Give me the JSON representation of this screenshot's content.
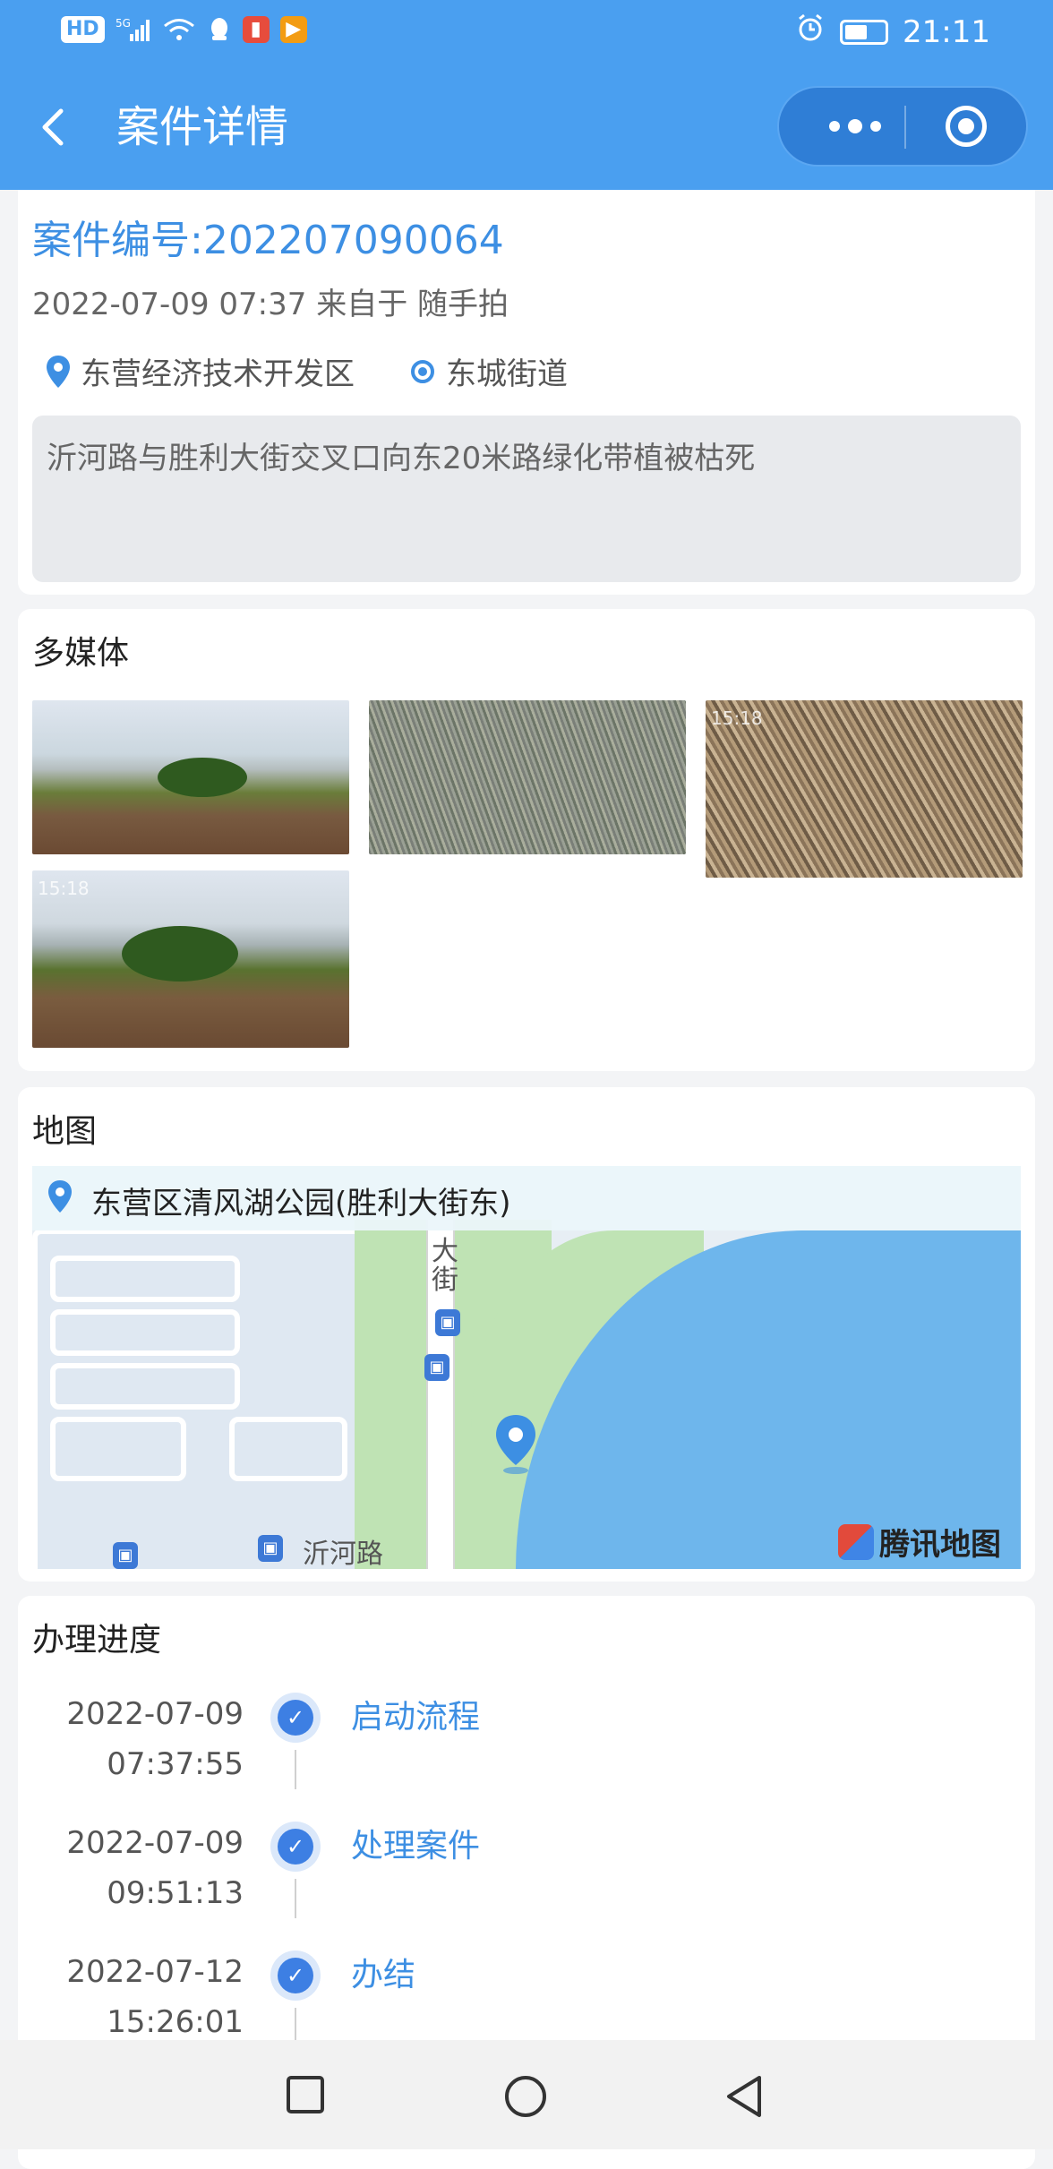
{
  "status_bar": {
    "left_icons": [
      "HD",
      "5G signal",
      "wifi",
      "qq",
      "app-red",
      "app-orange"
    ],
    "time": "21:11"
  },
  "header": {
    "title": "案件详情",
    "back_icon": "chevron-left-icon",
    "more_icon": "more-dots-icon",
    "target_icon": "target-icon"
  },
  "case": {
    "number": "案件编号:202207090064",
    "meta": "2022-07-09 07:37 来自于 随手拍",
    "location_1": "东营经济技术开发区",
    "location_2": "东城街道",
    "description": "沂河路与胜利大街交叉口向东20米路绿化带植被枯死"
  },
  "media": {
    "title": "多媒体",
    "images": [
      {
        "name": "photo-street-1",
        "stamp": ""
      },
      {
        "name": "photo-grass-1",
        "stamp": ""
      },
      {
        "name": "photo-grass-2",
        "stamp": "15:18"
      },
      {
        "name": "photo-street-2",
        "stamp": "15:18"
      }
    ]
  },
  "map": {
    "title": "地图",
    "location_label": "东营区清风湖公园(胜利大街东)",
    "road_label_1": "沂河路",
    "road_label_2": "大\n街",
    "brand": "腾讯地图"
  },
  "progress": {
    "title": "办理进度",
    "steps": [
      {
        "date": "2022-07-09",
        "time": "07:37:55",
        "label": "启动流程"
      },
      {
        "date": "2022-07-09",
        "time": "09:51:13",
        "label": "处理案件"
      },
      {
        "date": "2022-07-12",
        "time": "15:26:01",
        "label": "办结"
      }
    ]
  },
  "colors": {
    "header_bg": "#4a9ff0",
    "accent": "#3d8fe3"
  }
}
